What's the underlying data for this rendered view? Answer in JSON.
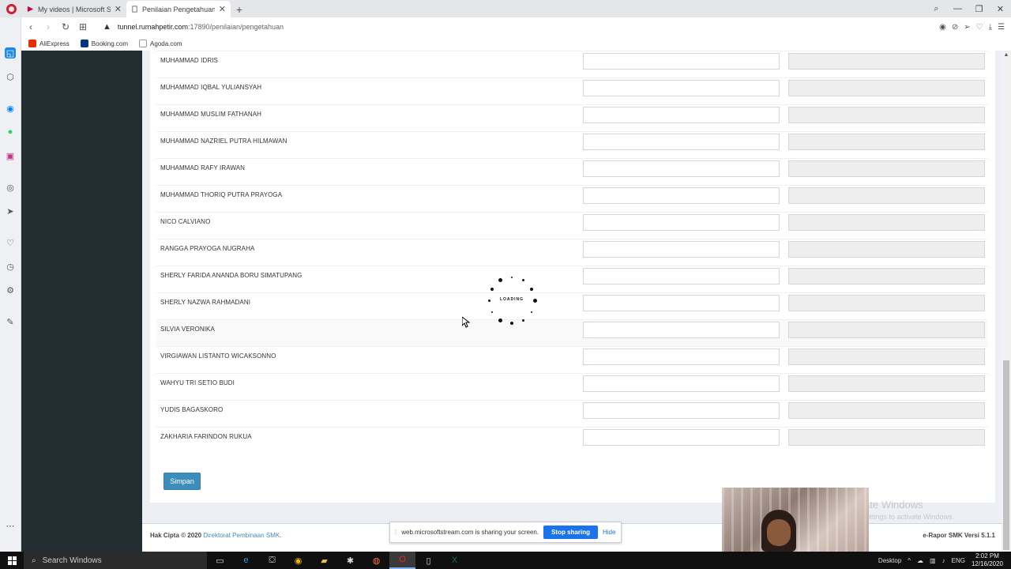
{
  "browser": {
    "tabs": [
      {
        "title": "My videos | Microsoft Strea",
        "active": false
      },
      {
        "title": "Penilaian Pengetahuan | e-r",
        "active": true
      }
    ],
    "url_host": "tunnel.rumahpetir.com",
    "url_rest": ":17890/penilaian/pengetahuan",
    "bookmarks": [
      "AliExpress",
      "Booking.com",
      "Agoda.com"
    ]
  },
  "students": [
    "MUHAMMAD IDRIS",
    "MUHAMMAD IQBAL YULIANSYAH",
    "MUHAMMAD MUSLIM FATHANAH",
    "MUHAMMAD NAZRIEL PUTRA HILMAWAN",
    "MUHAMMAD RAFY IRAWAN",
    "MUHAMMAD THORIQ PUTRA PRAYOGA",
    "NICO CALVIANO",
    "RANGGA PRAYOGA NUGRAHA",
    "SHERLY FARIDA ANANDA BORU SIMATUPANG",
    "SHERLY NAZWA RAHMADANI",
    "SILVIA VERONIKA",
    "VIRGIAWAN LISTANTO WICAKSONNO",
    "WAHYU TRI SETIO BUDI",
    "YUDIS BAGASKORO",
    "ZAKHARIA FARINDON RUKUA"
  ],
  "form": {
    "save_label": "Simpan",
    "loading_text": "LOADING"
  },
  "footer": {
    "copyright_prefix": "Hak Cipta © 2020",
    "copyright_link": "Direktorat Pembinaan SMK",
    "version": "e-Rapor SMK Versi 5.1.1"
  },
  "sharebar": {
    "message": "web.microsoftstream.com is sharing your screen.",
    "stop_label": "Stop sharing",
    "hide_label": "Hide"
  },
  "watermark": {
    "line1": "Activate Windows",
    "line2": "Go to Settings to activate Windows."
  },
  "taskbar": {
    "search_placeholder": "Search Windows",
    "lang": "ENG",
    "time": "2:02 PM",
    "date": "12/16/2020",
    "desktop_label": "Desktop"
  },
  "colors": {
    "accent": "#3c8dbc",
    "sidebar_dark": "#222d32",
    "opera_red": "#d01f2e"
  }
}
